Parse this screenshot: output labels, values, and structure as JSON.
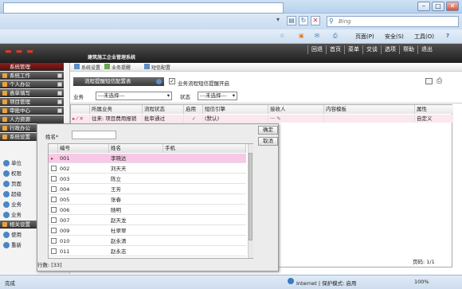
{
  "browser": {
    "search_placeholder": "Bing",
    "cmd": {
      "page": "页面(P)",
      "safety": "安全(S)",
      "tools": "工具(O)",
      "help": "?"
    },
    "status_left": "完成",
    "status_zone": "Internet | 保护模式: 启用",
    "zoom": "100%"
  },
  "app": {
    "system_name": "建筑施工企业管理系统",
    "top_nav": [
      "回退",
      "首页",
      "菜单",
      "交谈",
      "选项",
      "帮助",
      "退出"
    ],
    "menu": [
      "系统设置",
      "业务提醒",
      "短信配置"
    ],
    "sidebar_title": "系统管理"
  },
  "sidebar": {
    "groups": [
      "系统工作",
      "个人办公",
      "表单填写",
      "项目管理",
      "审批中心",
      "人力资源",
      "行政办公",
      "系统设置"
    ],
    "sub_items": [
      "单位",
      "权限",
      "页面",
      "超级",
      "业务",
      "业务"
    ],
    "group2": "相关设置",
    "sub_items2": [
      "使用",
      "重新"
    ]
  },
  "panel": {
    "title": "流程提醒短信配置表",
    "checkbox_label": "业务流程短信提醒开启",
    "checkbox_mark": "✓"
  },
  "filter": {
    "business_label": "业务",
    "business_value": "---未选择---",
    "status_label": "状态",
    "status_value": "---未选择---"
  },
  "grid": {
    "headers": [
      "所属业务",
      "流程状态",
      "启用",
      "短信引擎",
      "接收人",
      "内容模板",
      "属性"
    ],
    "row": {
      "business": "往来: 项目费用报销",
      "status": "批审通过",
      "engine": "(默认)",
      "receiver": "···",
      "attr": "自定义"
    },
    "pager": "页码: 1/1"
  },
  "popup": {
    "name_label": "姓名*",
    "ok": "确定",
    "cancel": "取消",
    "headers": [
      "编号",
      "姓名",
      "手机"
    ],
    "rows": [
      {
        "id": "001",
        "name": "李晓达"
      },
      {
        "id": "002",
        "name": "刘天天"
      },
      {
        "id": "003",
        "name": "陈立"
      },
      {
        "id": "004",
        "name": "王芳"
      },
      {
        "id": "005",
        "name": "张春"
      },
      {
        "id": "006",
        "name": "随明"
      },
      {
        "id": "007",
        "name": "赵天龙"
      },
      {
        "id": "009",
        "name": "杜翠翠"
      },
      {
        "id": "010",
        "name": "赵永清"
      },
      {
        "id": "011",
        "name": "赵永志"
      }
    ],
    "count": "行数: [33]"
  }
}
